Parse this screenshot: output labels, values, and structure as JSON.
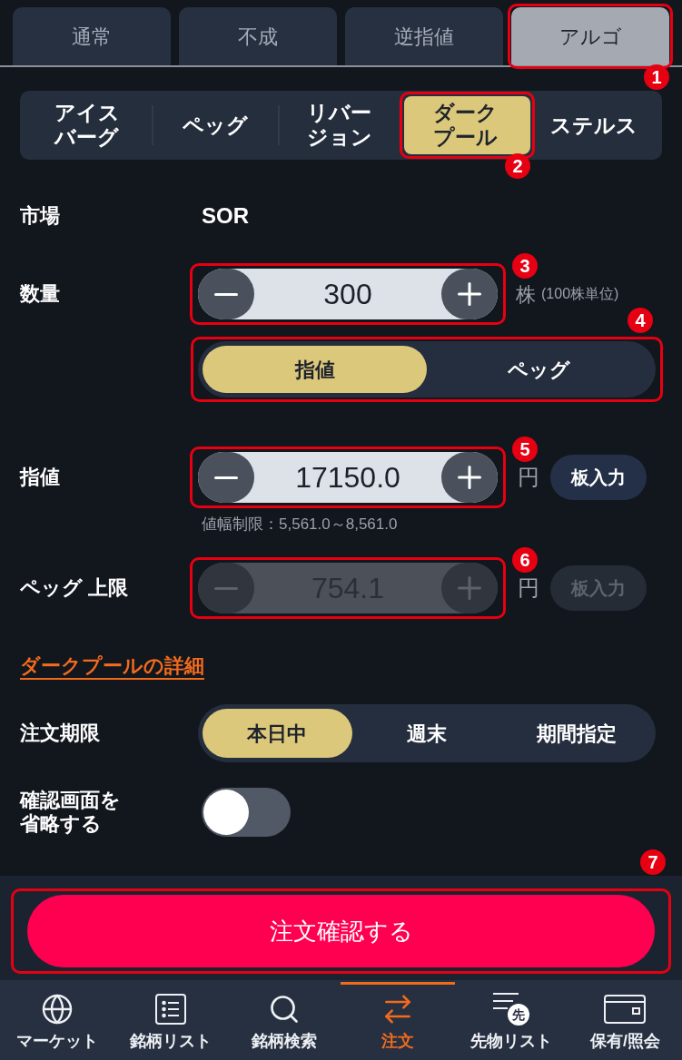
{
  "order_type_tabs": [
    {
      "label": "通常",
      "selected": false
    },
    {
      "label": "不成",
      "selected": false
    },
    {
      "label": "逆指値",
      "selected": false
    },
    {
      "label": "アルゴ",
      "selected": true,
      "callout": "1"
    }
  ],
  "algo_tabs": [
    {
      "label": "アイスバーグ",
      "selected": false
    },
    {
      "label": "ペッグ",
      "selected": false
    },
    {
      "label": "リバージョン",
      "selected": false
    },
    {
      "label": "ダークプール",
      "selected": true,
      "callout": "2"
    },
    {
      "label": "ステルス",
      "selected": false
    }
  ],
  "market": {
    "label": "市場",
    "value": "SOR"
  },
  "quantity": {
    "label": "数量",
    "value": "300",
    "unit": "株",
    "note": "(100株単位)",
    "disabled": false,
    "callout": "3"
  },
  "price_type": {
    "options": [
      {
        "label": "指値",
        "selected": true
      },
      {
        "label": "ペッグ",
        "selected": false
      }
    ],
    "callout": "4"
  },
  "limit_price": {
    "label": "指値",
    "value": "17150.0",
    "unit": "円",
    "board_button": "板入力",
    "disabled": false,
    "callout": "5",
    "note": "値幅制限：5,561.0～8,561.0"
  },
  "peg_limit": {
    "label": "ペッグ 上限",
    "value": "754.1",
    "unit": "円",
    "board_button": "板入力",
    "disabled": true,
    "callout": "6"
  },
  "details_link": "ダークプールの詳細",
  "expiry": {
    "label": "注文期限",
    "options": [
      {
        "label": "本日中",
        "selected": true
      },
      {
        "label": "週末",
        "selected": false
      },
      {
        "label": "期間指定",
        "selected": false
      }
    ]
  },
  "skip_confirmation": {
    "label": "確認画面を省略する",
    "on": false
  },
  "submit": {
    "label": "注文確認する",
    "callout": "7"
  },
  "bottom_nav": [
    {
      "label": "マーケット",
      "selected": false
    },
    {
      "label": "銘柄リスト",
      "selected": false
    },
    {
      "label": "銘柄検索",
      "selected": false
    },
    {
      "label": "注文",
      "selected": true
    },
    {
      "label": "先物リスト",
      "selected": false,
      "icon_text": "先"
    },
    {
      "label": "保有/照会",
      "selected": false
    }
  ]
}
